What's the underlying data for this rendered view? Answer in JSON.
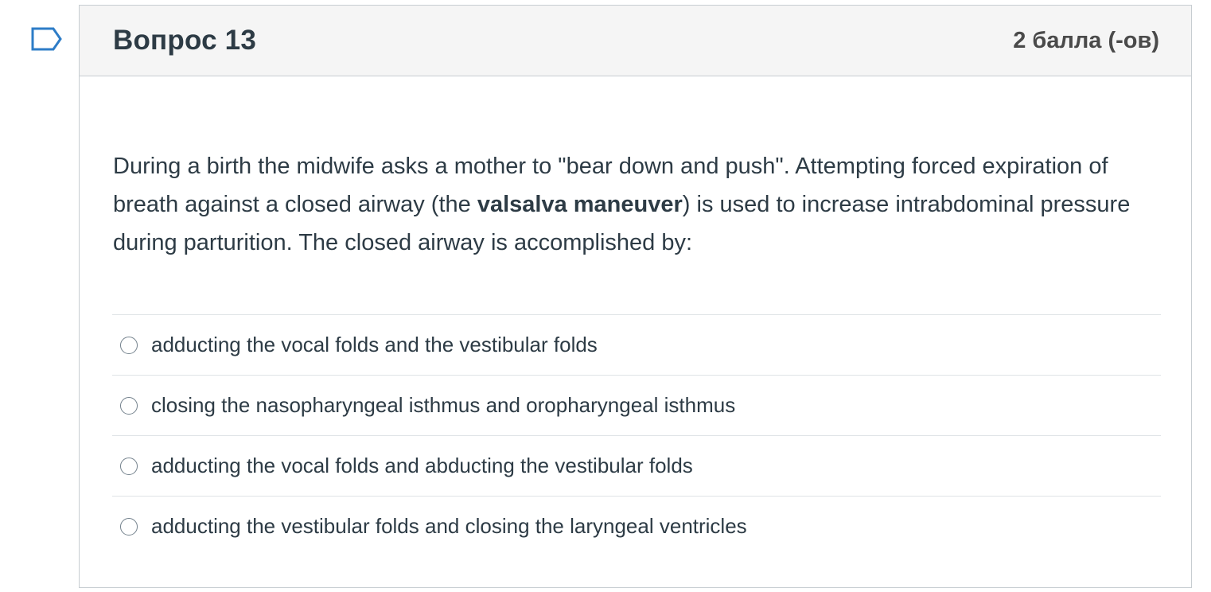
{
  "question": {
    "title": "Вопрос 13",
    "points": "2 балла (-ов)",
    "text_before": "During a birth the midwife asks a mother to \"bear down and push\".  Attempting forced expiration of breath against a closed airway (the ",
    "text_bold": "valsalva maneuver",
    "text_after": ") is used to increase intrabdominal pressure during parturition. The closed airway is accomplished by:"
  },
  "answers": [
    {
      "label": "adducting the vocal folds and the vestibular folds",
      "selected": false
    },
    {
      "label": "closing the nasopharyngeal isthmus and oropharyngeal isthmus",
      "selected": false
    },
    {
      "label": "adducting the vocal folds and abducting the vestibular folds",
      "selected": false
    },
    {
      "label": "adducting the vestibular folds and closing the laryngeal ventricles",
      "selected": false
    }
  ],
  "icons": {
    "flag": "bookmark-flag-icon",
    "radio": "radio-unchecked-icon"
  },
  "colors": {
    "flag_stroke": "#2d7cc7",
    "header_bg": "#f5f5f5",
    "border": "#c7cdd1",
    "text": "#2d3b45"
  }
}
